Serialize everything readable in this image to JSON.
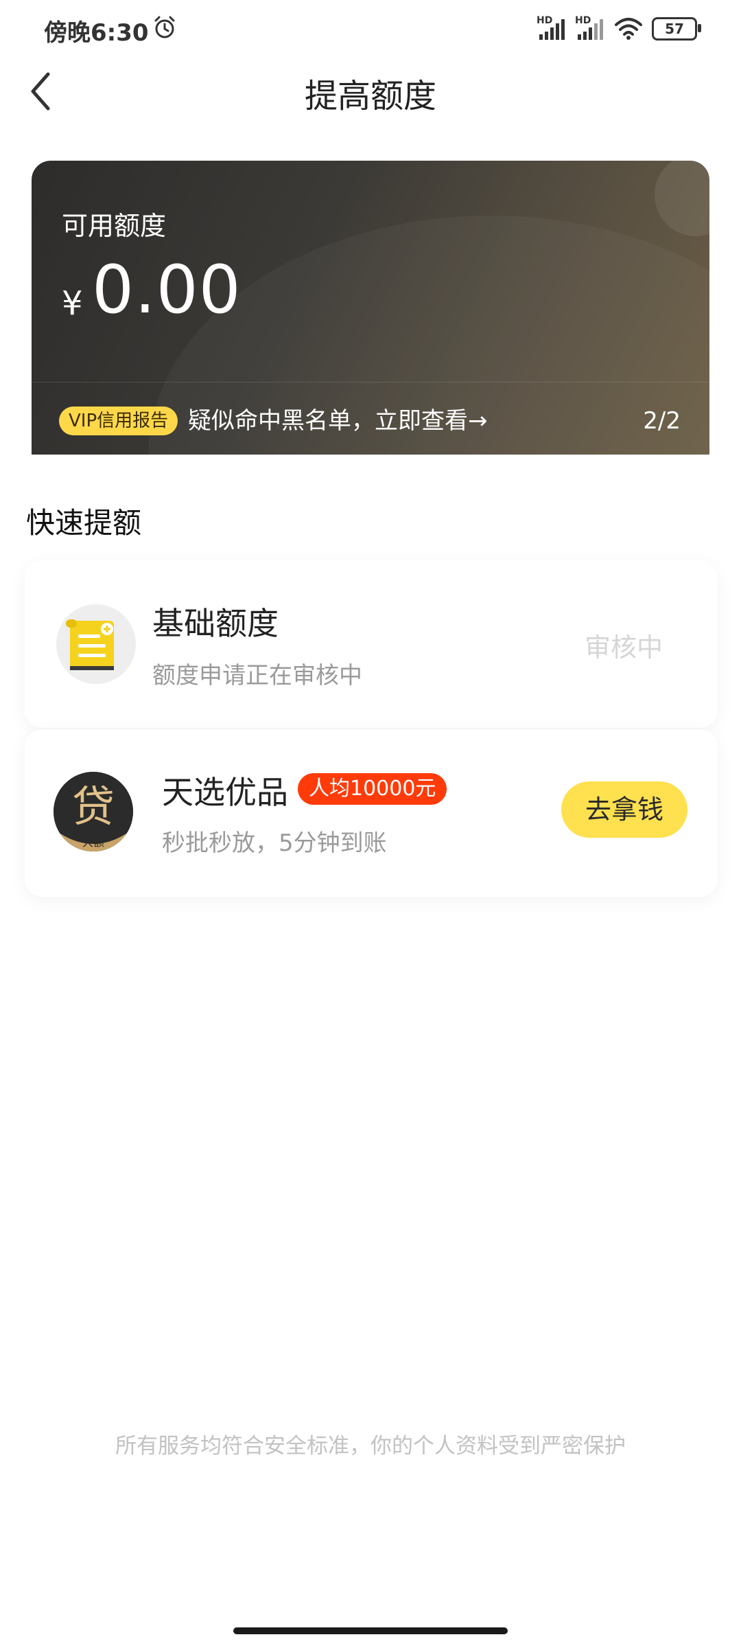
{
  "status_bar": {
    "time": "傍晚6:30",
    "signal1_label": "HD",
    "signal2_label": "HD",
    "battery": "57"
  },
  "nav": {
    "title": "提高额度"
  },
  "quota_card": {
    "label": "可用额度",
    "currency": "¥",
    "amount": "0.00",
    "vip_badge": "VIP信用报告",
    "vip_message": "疑似命中黑名单，立即查看→",
    "page_indicator": "2/2"
  },
  "quick": {
    "section_title": "快速提额",
    "items": [
      {
        "title": "基础额度",
        "subtitle": "额度申请正在审核中",
        "status": "审核中",
        "icon": "document-icon"
      },
      {
        "title": "天选优品",
        "badge": "人均10000元",
        "subtitle": "秒批秒放，5分钟到账",
        "button": "去拿钱",
        "logo_char": "贷",
        "logo_caption": "大额",
        "icon": "loan-logo"
      }
    ]
  },
  "footer_note": "所有服务均符合安全标准，你的个人资料受到严密保护",
  "colors": {
    "accent_yellow": "#ffe04e",
    "hot_red": "#ff3b0a",
    "card_dark": "#3c3a36"
  }
}
